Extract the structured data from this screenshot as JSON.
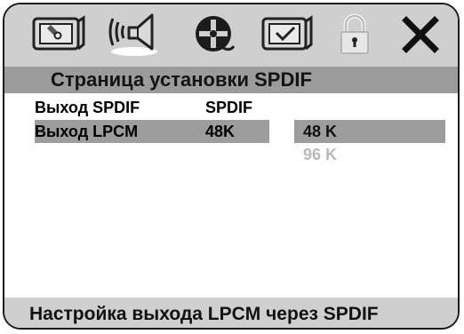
{
  "toolbar": {
    "icons": [
      "general-setup-icon",
      "audio-setup-icon",
      "video-setup-icon",
      "preference-setup-icon",
      "password-lock-icon",
      "exit-close-icon"
    ],
    "selected": "audio-setup-icon"
  },
  "page": {
    "title": "Страница установки SPDIF"
  },
  "settings": [
    {
      "label": "Выход SPDIF",
      "value": "SPDIF"
    },
    {
      "label": "Выход LPCM",
      "value": "48K"
    }
  ],
  "options": [
    {
      "label": "48 K",
      "state": "selected"
    },
    {
      "label": "96 K",
      "state": "disabled"
    }
  ],
  "help": {
    "text": "Настройка выхода LPCM через SPDIF"
  },
  "colors": {
    "toolbar_bg": "#cfcfcf",
    "title_bg": "#9b9b9b",
    "highlight": "#9d9d9d",
    "disabled_text": "#b8b8b8"
  }
}
